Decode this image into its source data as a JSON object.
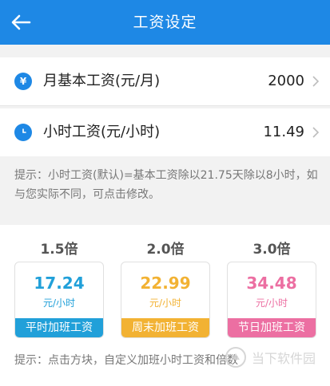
{
  "header": {
    "title": "工资设定"
  },
  "rows": [
    {
      "label": "月基本工资(元/月)",
      "value": "2000"
    },
    {
      "label": "小时工资(元/小时)",
      "value": "11.49"
    }
  ],
  "hint1": "提示：小时工资(默认)=基本工资除以21.75天除以8小时，如与您实际不同，可点击修改。",
  "overtime": [
    {
      "multiplier": "1.5倍",
      "value": "17.24",
      "unit": "元/小时",
      "label": "平时加班工资",
      "color": "#21a0d9"
    },
    {
      "multiplier": "2.0倍",
      "value": "22.99",
      "unit": "元/小时",
      "label": "周末加班工资",
      "color": "#f2b233"
    },
    {
      "multiplier": "3.0倍",
      "value": "34.48",
      "unit": "元/小时",
      "label": "节日加班工资",
      "color": "#ec6fa2"
    }
  ],
  "hint2": "提示：点击方块，自定义加班小时工资和倍数",
  "watermark": "当下软件园"
}
